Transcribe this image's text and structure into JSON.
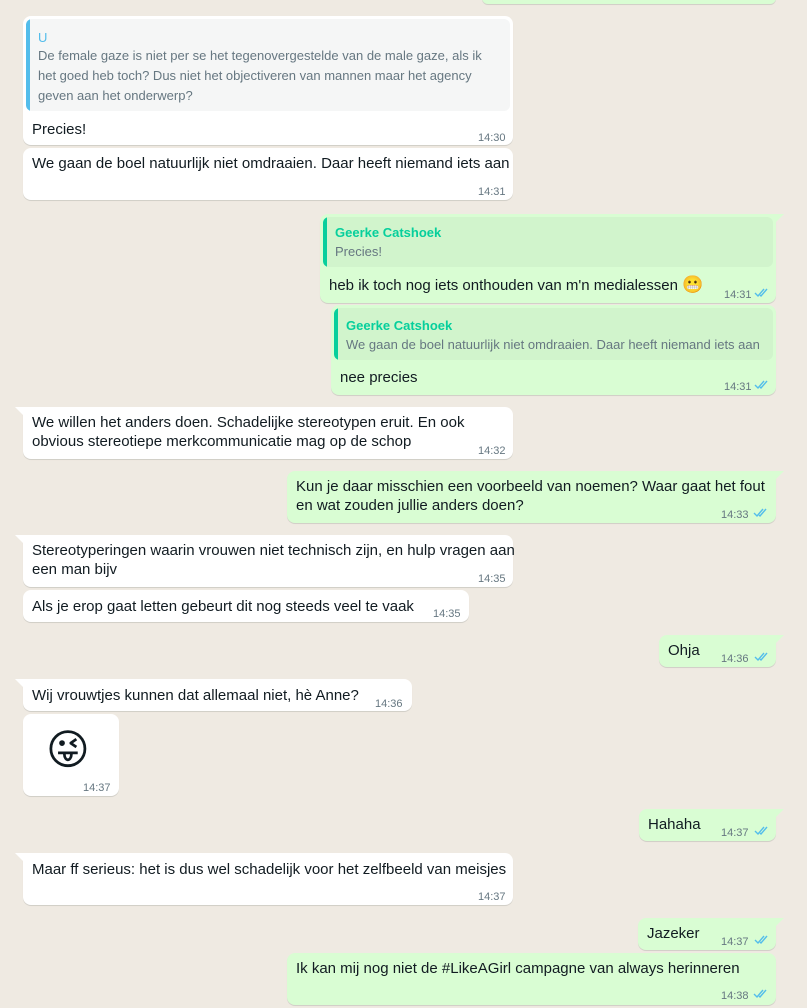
{
  "colors": {
    "background": "#efeae2",
    "incoming_bubble": "#ffffff",
    "outgoing_bubble": "#d9fdd3",
    "read_tick": "#53bdeb",
    "quote_author_accent": "#06cf9c"
  },
  "messages": [
    {
      "quote_author": "U",
      "quote_lines": [
        "De female gaze is niet per se het tegenovergestelde van de male gaze, als ik",
        "het goed heb toch? Dus niet het objectiveren van mannen maar het agency",
        "geven aan het onderwerp?"
      ],
      "text": "Precies!",
      "time": "14:30"
    },
    {
      "text": "We gaan de boel natuurlijk niet omdraaien. Daar heeft niemand iets aan",
      "time": "14:31"
    },
    {
      "quote_author": "Geerke Catshoek",
      "quote_text": "Precies!",
      "text": "heb ik toch nog iets onthouden van m'n medialessen",
      "emoji": "😬",
      "time": "14:31"
    },
    {
      "quote_author": "Geerke Catshoek",
      "quote_text": "We gaan de boel natuurlijk niet omdraaien. Daar heeft niemand iets aan",
      "text": "nee precies",
      "time": "14:31"
    },
    {
      "lines": [
        "We willen het anders doen. Schadelijke stereotypen eruit. En ook",
        "obvious stereotiepe merkcommunicatie mag op de schop"
      ],
      "time": "14:32"
    },
    {
      "lines": [
        "Kun je daar misschien een voorbeeld van noemen? Waar gaat het fout",
        "en wat zouden jullie anders doen?"
      ],
      "time": "14:33"
    },
    {
      "lines": [
        "Stereotyperingen waarin vrouwen niet technisch zijn, en hulp vragen aan",
        "een man bijv"
      ],
      "time": "14:35"
    },
    {
      "text": "Als je erop gaat letten gebeurt dit nog steeds veel te vaak",
      "time": "14:35"
    },
    {
      "text": "Ohja",
      "time": "14:36"
    },
    {
      "text": "Wij vrouwtjes kunnen dat allemaal niet, hè Anne?",
      "time": "14:36"
    },
    {
      "emoji": "😜",
      "time": "14:37"
    },
    {
      "text": "Hahaha",
      "time": "14:37"
    },
    {
      "text": "Maar ff serieus: het is dus wel schadelijk voor het zelfbeeld van meisjes",
      "time": "14:37"
    },
    {
      "text": "Jazeker",
      "time": "14:37"
    },
    {
      "text": "Ik kan mij nog niet de #LikeAGirl campagne van always herinneren",
      "time": "14:38"
    }
  ]
}
